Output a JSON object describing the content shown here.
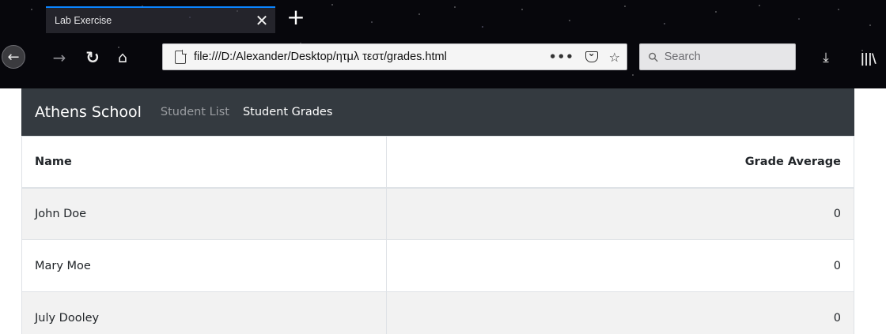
{
  "browser": {
    "tab_title": "Lab Exercise",
    "tab_close_icon": "close-icon",
    "new_tab_label": "+",
    "url": "file:///D:/Alexander/Desktop/ητμλ τεστ/grades.html",
    "search_placeholder": "Search",
    "icons": {
      "back": "back-arrow-icon",
      "forward": "forward-arrow-icon",
      "reload": "reload-icon",
      "home": "home-icon",
      "page": "page-icon",
      "more": "more-icon",
      "pocket": "pocket-icon",
      "bookmark": "star-icon",
      "search": "search-icon",
      "download": "download-icon",
      "library": "library-icon"
    }
  },
  "navbar": {
    "brand": "Athens School",
    "links": [
      {
        "label": "Student List",
        "active": false
      },
      {
        "label": "Student Grades",
        "active": true
      }
    ],
    "background": "#343a40"
  },
  "table": {
    "columns": [
      "Name",
      "Grade Average"
    ],
    "rows": [
      {
        "name": "John Doe",
        "grade_average": "0"
      },
      {
        "name": "Mary Moe",
        "grade_average": "0"
      },
      {
        "name": "July Dooley",
        "grade_average": "0"
      }
    ],
    "stripe_color": "#f2f2f2"
  }
}
